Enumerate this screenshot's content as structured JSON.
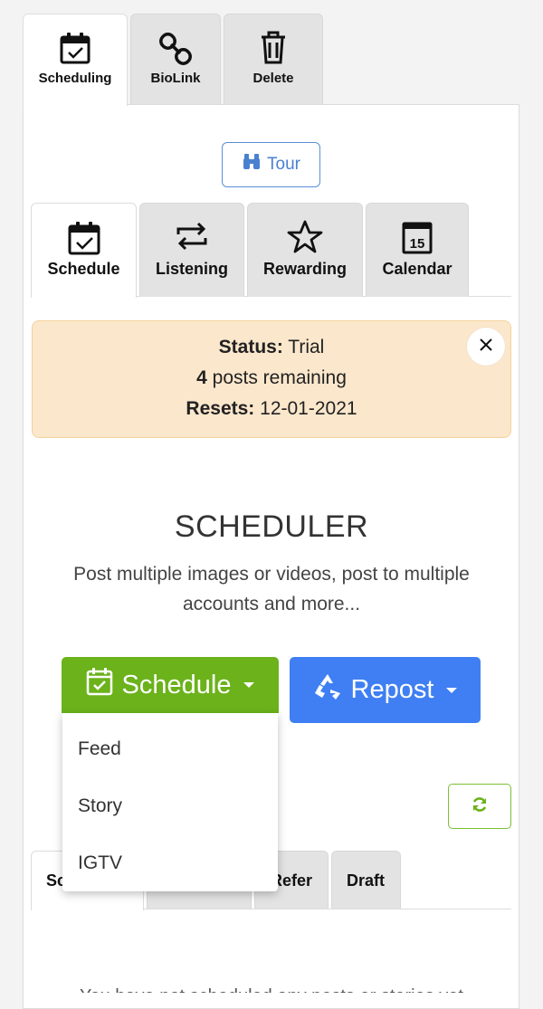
{
  "top_tabs": [
    {
      "label": "Scheduling",
      "icon": "calendar-check-icon",
      "active": true
    },
    {
      "label": "BioLink",
      "icon": "link-icon",
      "active": false
    },
    {
      "label": "Delete",
      "icon": "trash-icon",
      "active": false
    }
  ],
  "tour": {
    "label": "Tour",
    "icon": "binoculars-icon"
  },
  "sub_tabs": [
    {
      "label": "Schedule",
      "icon": "calendar-check-icon",
      "active": true
    },
    {
      "label": "Listening",
      "icon": "repeat-icon",
      "active": false
    },
    {
      "label": "Rewarding",
      "icon": "star-icon",
      "active": false
    },
    {
      "label": "Calendar",
      "icon": "calendar-15-icon",
      "active": false,
      "badge": "15"
    }
  ],
  "status": {
    "status_label": "Status:",
    "status_value": "Trial",
    "posts_count": "4",
    "posts_text": "posts remaining",
    "resets_label": "Resets:",
    "resets_value": "12-01-2021"
  },
  "main": {
    "heading": "SCHEDULER",
    "description": "Post multiple images or videos, post to multiple accounts and more..."
  },
  "actions": {
    "schedule_label": "Schedule",
    "repost_label": "Repost",
    "schedule_color": "#6bb21b",
    "repost_color": "#3f7ff3"
  },
  "dropdown": {
    "items": [
      "Feed",
      "Story",
      "IGTV"
    ]
  },
  "bottom_tabs": [
    {
      "label": "Sc",
      "active": true
    },
    {
      "label": "",
      "active": false
    },
    {
      "label": "Refer",
      "active": false
    },
    {
      "label": "Draft",
      "active": false
    }
  ],
  "footer_cutoff": "You have not scheduled any posts or stories yet"
}
